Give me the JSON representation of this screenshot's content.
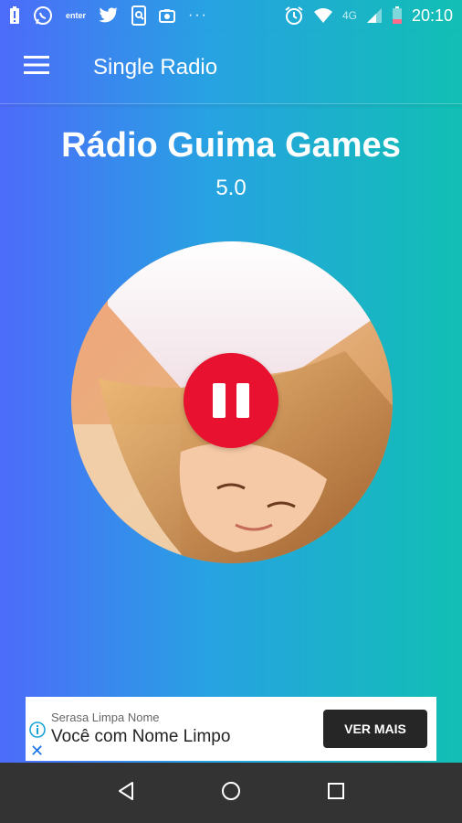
{
  "status_bar": {
    "left_icons": [
      "battery-alert-icon",
      "whatsapp-icon",
      "enter-icon",
      "twitter-icon",
      "phone-doc-icon",
      "camera-icon"
    ],
    "enter_label": "enter",
    "more_label": "···",
    "right_icons": [
      "alarm-icon",
      "wifi-icon",
      "signal-icon",
      "battery-icon"
    ],
    "network": "4G",
    "time": "20:10"
  },
  "app_bar": {
    "title": "Single Radio",
    "menu_icon": "hamburger-menu-icon"
  },
  "station": {
    "name": "Rádio Guima Games",
    "rating": "5.0"
  },
  "player": {
    "state": "playing",
    "control_icon": "pause-icon",
    "accent_color": "#e8112f"
  },
  "ad": {
    "brand": "Serasa Limpa Nome",
    "headline": "Você com Nome Limpo",
    "cta": "VER MAIS",
    "icons": [
      "info-icon",
      "close-icon"
    ]
  },
  "nav_bar": {
    "buttons": [
      "back-icon",
      "home-icon",
      "recents-icon"
    ]
  },
  "colors": {
    "gradient_start": "#4d6bfa",
    "gradient_end": "#11bfb4",
    "nav_bar": "#333333"
  }
}
